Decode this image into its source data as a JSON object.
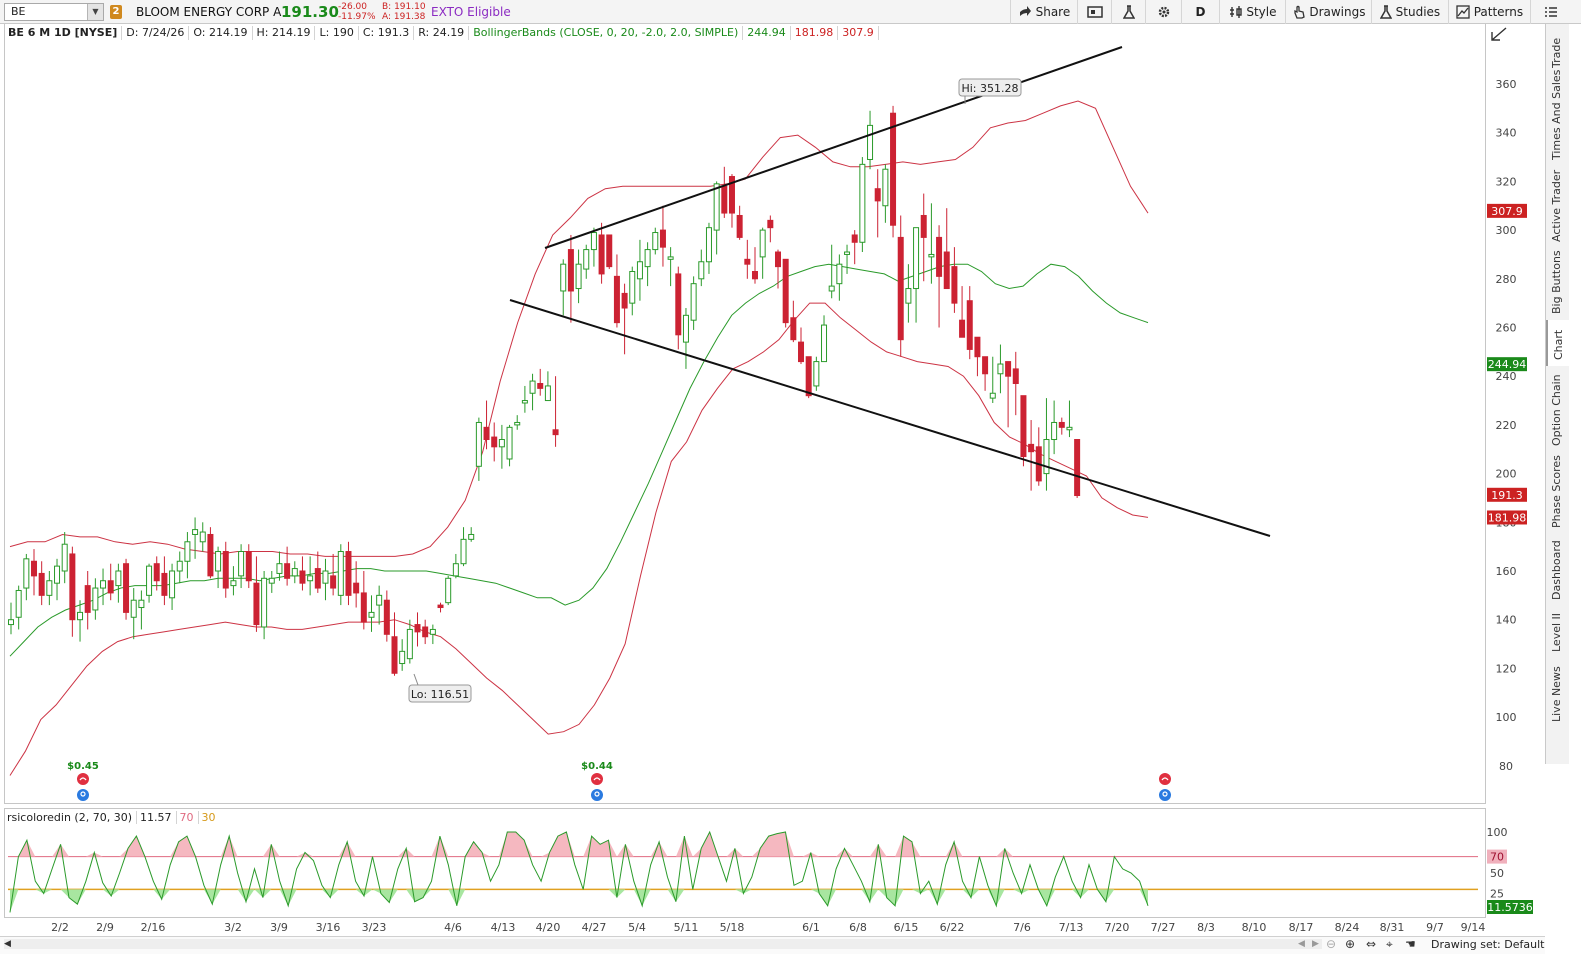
{
  "toolbar": {
    "symbol": "BE",
    "link_group": "2",
    "company": "BLOOM ENERGY CORP A",
    "last": "191.30",
    "change": "-26.00",
    "change_pct": "-11.97%",
    "bid": "B: 191.10",
    "ask": "A: 191.38",
    "exto": "EXTO Eligible",
    "share": "Share",
    "timeframe": "D",
    "style": "Style",
    "drawings": "Drawings",
    "studies": "Studies",
    "patterns": "Patterns"
  },
  "header": {
    "symbol_desc": "BE 6 M 1D [NYSE]",
    "date": "D: 7/24/26",
    "open": "O: 214.19",
    "high": "H: 214.19",
    "low": "L: 190",
    "close": "C: 191.3",
    "range": "R: 24.19",
    "bb_label": "BollingerBands (CLOSE, 0, 20, -2.0, 2.0, SIMPLE)",
    "bb_mid": "244.94",
    "bb_lower": "181.98",
    "bb_upper": "307.9"
  },
  "chart_data": {
    "type": "candlestick",
    "symbol": "BE",
    "timeframe": "1D",
    "ylim": [
      70,
      375
    ],
    "yticks": [
      80,
      100,
      120,
      140,
      160,
      180,
      200,
      220,
      240,
      260,
      280,
      300,
      320,
      340,
      360
    ],
    "xtick_labels": [
      "2/2",
      "2/9",
      "2/16",
      "3/2",
      "3/9",
      "3/16",
      "3/23",
      "4/6",
      "4/13",
      "4/20",
      "4/27",
      "5/4",
      "5/11",
      "5/18",
      "6/1",
      "6/8",
      "6/15",
      "6/22",
      "7/6",
      "7/13",
      "7/20",
      "7/27",
      "8/3",
      "8/10",
      "8/17",
      "8/24",
      "8/31",
      "9/7",
      "9/14"
    ],
    "candles": [
      {
        "o": 138,
        "h": 147,
        "l": 134,
        "c": 140
      },
      {
        "o": 141,
        "h": 154,
        "l": 136,
        "c": 152
      },
      {
        "o": 153,
        "h": 167,
        "l": 148,
        "c": 165
      },
      {
        "o": 164,
        "h": 169,
        "l": 150,
        "c": 158
      },
      {
        "o": 159,
        "h": 164,
        "l": 146,
        "c": 150
      },
      {
        "o": 150,
        "h": 160,
        "l": 146,
        "c": 156
      },
      {
        "o": 155,
        "h": 165,
        "l": 148,
        "c": 162
      },
      {
        "o": 160,
        "h": 176,
        "l": 155,
        "c": 171
      },
      {
        "o": 167,
        "h": 170,
        "l": 133,
        "c": 140
      },
      {
        "o": 140,
        "h": 148,
        "l": 131,
        "c": 143
      },
      {
        "o": 154,
        "h": 160,
        "l": 136,
        "c": 143
      },
      {
        "o": 144,
        "h": 157,
        "l": 140,
        "c": 153
      },
      {
        "o": 153,
        "h": 161,
        "l": 146,
        "c": 156
      },
      {
        "o": 156,
        "h": 163,
        "l": 148,
        "c": 151
      },
      {
        "o": 154,
        "h": 163,
        "l": 147,
        "c": 160
      },
      {
        "o": 163,
        "h": 165,
        "l": 140,
        "c": 143
      },
      {
        "o": 141,
        "h": 153,
        "l": 132,
        "c": 148
      },
      {
        "o": 145,
        "h": 152,
        "l": 136,
        "c": 148
      },
      {
        "o": 150,
        "h": 163,
        "l": 147,
        "c": 162
      },
      {
        "o": 163,
        "h": 166,
        "l": 152,
        "c": 156
      },
      {
        "o": 159,
        "h": 166,
        "l": 146,
        "c": 150
      },
      {
        "o": 149,
        "h": 163,
        "l": 144,
        "c": 160
      },
      {
        "o": 160,
        "h": 168,
        "l": 155,
        "c": 164
      },
      {
        "o": 164,
        "h": 176,
        "l": 157,
        "c": 172
      },
      {
        "o": 175,
        "h": 182,
        "l": 165,
        "c": 177
      },
      {
        "o": 172,
        "h": 180,
        "l": 168,
        "c": 176
      },
      {
        "o": 175,
        "h": 178,
        "l": 157,
        "c": 158
      },
      {
        "o": 160,
        "h": 170,
        "l": 153,
        "c": 168
      },
      {
        "o": 168,
        "h": 172,
        "l": 149,
        "c": 153
      },
      {
        "o": 154,
        "h": 162,
        "l": 150,
        "c": 156
      },
      {
        "o": 158,
        "h": 171,
        "l": 153,
        "c": 168
      },
      {
        "o": 168,
        "h": 171,
        "l": 153,
        "c": 156
      },
      {
        "o": 155,
        "h": 166,
        "l": 135,
        "c": 138
      },
      {
        "o": 137,
        "h": 160,
        "l": 132,
        "c": 157
      },
      {
        "o": 155,
        "h": 160,
        "l": 151,
        "c": 157
      },
      {
        "o": 159,
        "h": 168,
        "l": 156,
        "c": 163
      },
      {
        "o": 163,
        "h": 170,
        "l": 154,
        "c": 157
      },
      {
        "o": 158,
        "h": 164,
        "l": 155,
        "c": 161
      },
      {
        "o": 160,
        "h": 166,
        "l": 152,
        "c": 155
      },
      {
        "o": 156,
        "h": 166,
        "l": 150,
        "c": 158
      },
      {
        "o": 161,
        "h": 168,
        "l": 151,
        "c": 153
      },
      {
        "o": 155,
        "h": 165,
        "l": 148,
        "c": 160
      },
      {
        "o": 158,
        "h": 167,
        "l": 150,
        "c": 153
      },
      {
        "o": 150,
        "h": 171,
        "l": 146,
        "c": 168
      },
      {
        "o": 168,
        "h": 172,
        "l": 146,
        "c": 150
      },
      {
        "o": 155,
        "h": 164,
        "l": 145,
        "c": 151
      },
      {
        "o": 151,
        "h": 160,
        "l": 136,
        "c": 139
      },
      {
        "o": 141,
        "h": 150,
        "l": 135,
        "c": 143
      },
      {
        "o": 146,
        "h": 154,
        "l": 138,
        "c": 150
      },
      {
        "o": 148,
        "h": 152,
        "l": 131,
        "c": 134
      },
      {
        "o": 133,
        "h": 143,
        "l": 117,
        "c": 118
      },
      {
        "o": 122,
        "h": 132,
        "l": 119,
        "c": 127
      },
      {
        "o": 124,
        "h": 140,
        "l": 122,
        "c": 136
      },
      {
        "o": 138,
        "h": 143,
        "l": 129,
        "c": 135
      },
      {
        "o": 137,
        "h": 140,
        "l": 130,
        "c": 133
      },
      {
        "o": 134,
        "h": 138,
        "l": 130,
        "c": 136
      },
      {
        "o": 146,
        "h": 147,
        "l": 143,
        "c": 145
      },
      {
        "o": 147,
        "h": 158,
        "l": 146,
        "c": 157
      },
      {
        "o": 158,
        "h": 167,
        "l": 157,
        "c": 163
      },
      {
        "o": 163,
        "h": 178,
        "l": 162,
        "c": 173
      },
      {
        "o": 173,
        "h": 178,
        "l": 172,
        "c": 175
      },
      {
        "o": 203,
        "h": 223,
        "l": 197,
        "c": 221
      },
      {
        "o": 219,
        "h": 230,
        "l": 210,
        "c": 214
      },
      {
        "o": 215,
        "h": 221,
        "l": 205,
        "c": 211
      },
      {
        "o": 211,
        "h": 220,
        "l": 202,
        "c": 214
      },
      {
        "o": 206,
        "h": 220,
        "l": 203,
        "c": 219
      },
      {
        "o": 220,
        "h": 224,
        "l": 218,
        "c": 221
      },
      {
        "o": 229,
        "h": 236,
        "l": 225,
        "c": 230
      },
      {
        "o": 233,
        "h": 241,
        "l": 226,
        "c": 238
      },
      {
        "o": 237,
        "h": 243,
        "l": 232,
        "c": 235
      },
      {
        "o": 230,
        "h": 242,
        "l": 230,
        "c": 236
      },
      {
        "o": 218,
        "h": 240,
        "l": 211,
        "c": 216
      },
      {
        "o": 275,
        "h": 288,
        "l": 265,
        "c": 286
      },
      {
        "o": 292,
        "h": 298,
        "l": 262,
        "c": 275
      },
      {
        "o": 276,
        "h": 292,
        "l": 270,
        "c": 286
      },
      {
        "o": 284,
        "h": 294,
        "l": 280,
        "c": 292
      },
      {
        "o": 292,
        "h": 301,
        "l": 285,
        "c": 299
      },
      {
        "o": 298,
        "h": 303,
        "l": 278,
        "c": 282
      },
      {
        "o": 298,
        "h": 298,
        "l": 284,
        "c": 285
      },
      {
        "o": 281,
        "h": 290,
        "l": 260,
        "c": 262
      },
      {
        "o": 274,
        "h": 278,
        "l": 249,
        "c": 268
      },
      {
        "o": 270,
        "h": 285,
        "l": 265,
        "c": 283
      },
      {
        "o": 280,
        "h": 296,
        "l": 271,
        "c": 287
      },
      {
        "o": 285,
        "h": 295,
        "l": 277,
        "c": 292
      },
      {
        "o": 292,
        "h": 301,
        "l": 290,
        "c": 299
      },
      {
        "o": 300,
        "h": 310,
        "l": 285,
        "c": 293
      },
      {
        "o": 288,
        "h": 293,
        "l": 277,
        "c": 289
      },
      {
        "o": 282,
        "h": 285,
        "l": 251,
        "c": 257
      },
      {
        "o": 254,
        "h": 268,
        "l": 243,
        "c": 265
      },
      {
        "o": 263,
        "h": 281,
        "l": 259,
        "c": 278
      },
      {
        "o": 280,
        "h": 292,
        "l": 277,
        "c": 287
      },
      {
        "o": 287,
        "h": 303,
        "l": 282,
        "c": 301
      },
      {
        "o": 300,
        "h": 320,
        "l": 290,
        "c": 319
      },
      {
        "o": 318,
        "h": 326,
        "l": 305,
        "c": 307
      },
      {
        "o": 322,
        "h": 323,
        "l": 301,
        "c": 307
      },
      {
        "o": 306,
        "h": 310,
        "l": 296,
        "c": 297
      },
      {
        "o": 288,
        "h": 296,
        "l": 280,
        "c": 286
      },
      {
        "o": 283,
        "h": 293,
        "l": 278,
        "c": 280
      },
      {
        "o": 289,
        "h": 301,
        "l": 280,
        "c": 300
      },
      {
        "o": 304,
        "h": 306,
        "l": 295,
        "c": 301
      },
      {
        "o": 291,
        "h": 292,
        "l": 276,
        "c": 285
      },
      {
        "o": 288,
        "h": 288,
        "l": 260,
        "c": 262
      },
      {
        "o": 264,
        "h": 271,
        "l": 254,
        "c": 255
      },
      {
        "o": 254,
        "h": 260,
        "l": 245,
        "c": 246
      },
      {
        "o": 248,
        "h": 248,
        "l": 231,
        "c": 232
      },
      {
        "o": 236,
        "h": 248,
        "l": 234,
        "c": 246
      },
      {
        "o": 246,
        "h": 265,
        "l": 246,
        "c": 261
      },
      {
        "o": 275,
        "h": 294,
        "l": 272,
        "c": 277
      },
      {
        "o": 278,
        "h": 290,
        "l": 271,
        "c": 286
      },
      {
        "o": 290,
        "h": 294,
        "l": 282,
        "c": 291
      },
      {
        "o": 298,
        "h": 300,
        "l": 286,
        "c": 295
      },
      {
        "o": 295,
        "h": 330,
        "l": 291,
        "c": 327
      },
      {
        "o": 329,
        "h": 349,
        "l": 325,
        "c": 343
      },
      {
        "o": 317,
        "h": 325,
        "l": 297,
        "c": 312
      },
      {
        "o": 310,
        "h": 327,
        "l": 303,
        "c": 325
      },
      {
        "o": 348,
        "h": 351,
        "l": 297,
        "c": 302
      },
      {
        "o": 297,
        "h": 306,
        "l": 248,
        "c": 255
      },
      {
        "o": 270,
        "h": 286,
        "l": 262,
        "c": 276
      },
      {
        "o": 276,
        "h": 296,
        "l": 262,
        "c": 301
      },
      {
        "o": 306,
        "h": 315,
        "l": 279,
        "c": 297
      },
      {
        "o": 289,
        "h": 311,
        "l": 278,
        "c": 290
      },
      {
        "o": 297,
        "h": 302,
        "l": 260,
        "c": 281
      },
      {
        "o": 291,
        "h": 309,
        "l": 277,
        "c": 276
      },
      {
        "o": 285,
        "h": 293,
        "l": 266,
        "c": 270
      },
      {
        "o": 263,
        "h": 277,
        "l": 257,
        "c": 256
      },
      {
        "o": 271,
        "h": 277,
        "l": 247,
        "c": 251
      },
      {
        "o": 256,
        "h": 256,
        "l": 240,
        "c": 248
      },
      {
        "o": 248,
        "h": 248,
        "l": 234,
        "c": 241
      },
      {
        "o": 231,
        "h": 248,
        "l": 229,
        "c": 233
      },
      {
        "o": 241,
        "h": 253,
        "l": 233,
        "c": 245
      },
      {
        "o": 246,
        "h": 246,
        "l": 219,
        "c": 240
      },
      {
        "o": 243,
        "h": 250,
        "l": 224,
        "c": 237
      },
      {
        "o": 232,
        "h": 232,
        "l": 203,
        "c": 207
      },
      {
        "o": 212,
        "h": 222,
        "l": 193,
        "c": 209
      },
      {
        "o": 211,
        "h": 219,
        "l": 195,
        "c": 197
      },
      {
        "o": 200,
        "h": 231,
        "l": 193,
        "c": 214
      },
      {
        "o": 214,
        "h": 230,
        "l": 208,
        "c": 221
      },
      {
        "o": 221,
        "h": 223,
        "l": 216,
        "c": 219
      },
      {
        "o": 218,
        "h": 230,
        "l": 215,
        "c": 219
      },
      {
        "o": 214,
        "h": 214,
        "l": 190,
        "c": 191
      }
    ],
    "bollinger": {
      "mid": [
        125,
        131,
        137,
        141,
        144,
        146,
        148,
        151,
        153,
        154,
        154,
        154,
        155,
        156,
        156,
        157,
        157,
        157,
        156,
        157,
        158,
        158,
        159,
        159,
        160,
        161,
        161,
        160,
        160,
        160,
        160,
        159,
        158,
        157,
        156,
        155,
        153,
        151,
        149,
        149,
        146,
        148,
        153,
        161,
        172,
        184,
        196,
        209,
        222,
        235,
        246,
        256,
        265,
        270,
        274,
        277,
        281,
        283,
        285,
        286,
        285,
        284,
        283,
        282,
        279,
        281,
        283,
        285,
        286,
        286,
        283,
        278,
        276,
        277,
        282,
        286,
        285,
        281,
        275,
        270,
        266,
        264,
        262
      ],
      "upper": [
        170,
        172,
        172,
        175,
        174,
        174,
        172,
        171,
        172,
        171,
        169,
        168,
        167,
        168,
        168,
        168,
        167,
        167,
        166,
        166,
        166,
        166,
        166,
        167,
        170,
        178,
        189,
        209,
        238,
        262,
        282,
        298,
        305,
        313,
        317,
        318,
        318,
        318,
        318,
        318,
        318,
        319,
        321,
        330,
        338,
        339,
        334,
        328,
        326,
        326,
        327,
        328,
        327,
        328,
        329,
        334,
        342,
        344,
        345,
        348,
        351,
        353,
        350,
        334,
        318,
        307
      ],
      "lower": [
        76,
        86,
        99,
        105,
        113,
        121,
        127,
        131,
        133,
        134,
        135,
        136,
        137,
        138,
        139,
        138,
        137,
        137,
        136,
        136,
        137,
        138,
        139,
        139,
        139,
        140,
        138,
        135,
        133,
        128,
        122,
        116,
        111,
        105,
        99,
        93,
        94,
        97,
        105,
        116,
        130,
        158,
        184,
        205,
        213,
        226,
        235,
        243,
        246,
        250,
        255,
        263,
        270,
        270,
        264,
        259,
        254,
        250,
        248,
        246,
        245,
        244,
        240,
        232,
        221,
        215,
        212,
        208,
        205,
        202,
        199,
        190,
        186,
        183,
        182
      ]
    },
    "trendlines": [
      {
        "x1": 545,
        "y1": 248,
        "x2": 1122,
        "y2": 47
      },
      {
        "x1": 510,
        "y1": 300,
        "x2": 1270,
        "y2": 536
      }
    ],
    "hi_label": "Hi: 351.28",
    "lo_label": "Lo: 116.51",
    "dividends": [
      {
        "label": "$0.45"
      },
      {
        "label": "$0.44"
      }
    ],
    "price_badges": [
      {
        "value": "307.9",
        "color": "#cc2222"
      },
      {
        "value": "244.94",
        "color": "#1a8a1a"
      },
      {
        "value": "191.3",
        "color": "#cc2222"
      },
      {
        "value": "181.98",
        "color": "#cc2222"
      }
    ]
  },
  "rsi": {
    "label": "rsicoloredin (2, 70, 30)",
    "value": "11.57",
    "overbought": "70",
    "oversold": "30",
    "value_badge": "11.5736",
    "yticks": [
      "100",
      "50",
      "25"
    ],
    "values": [
      2,
      70,
      90,
      40,
      25,
      55,
      85,
      20,
      12,
      40,
      75,
      38,
      22,
      50,
      80,
      95,
      70,
      40,
      18,
      60,
      88,
      95,
      70,
      35,
      12,
      60,
      95,
      50,
      15,
      55,
      20,
      85,
      40,
      10,
      55,
      75,
      65,
      35,
      20,
      60,
      88,
      40,
      22,
      70,
      25,
      14,
      55,
      80,
      15,
      20,
      40,
      95,
      60,
      10,
      70,
      88,
      75,
      40,
      60,
      100,
      100,
      90,
      60,
      40,
      75,
      95,
      100,
      60,
      30,
      95,
      85,
      90,
      20,
      85,
      40,
      10,
      60,
      88,
      45,
      15,
      95,
      30,
      80,
      100,
      70,
      40,
      80,
      25,
      45,
      80,
      95,
      98,
      100,
      35,
      40,
      75,
      25,
      10,
      55,
      80,
      60,
      40,
      15,
      85,
      20,
      10,
      95,
      88,
      25,
      40,
      12,
      60,
      88,
      40,
      20,
      70,
      35,
      10,
      80,
      50,
      25,
      60,
      30,
      10,
      45,
      70,
      40,
      20,
      60,
      30,
      15,
      70,
      55,
      50,
      40,
      10
    ]
  },
  "sidebar": {
    "tabs": [
      "Trade",
      "Times And Sales",
      "Active Trader",
      "Big Buttons",
      "Chart",
      "Option Chain",
      "Phase Scores",
      "Dashboard",
      "Level II",
      "Live News"
    ]
  },
  "footer": {
    "drawing_set": "Drawing set: Default"
  }
}
